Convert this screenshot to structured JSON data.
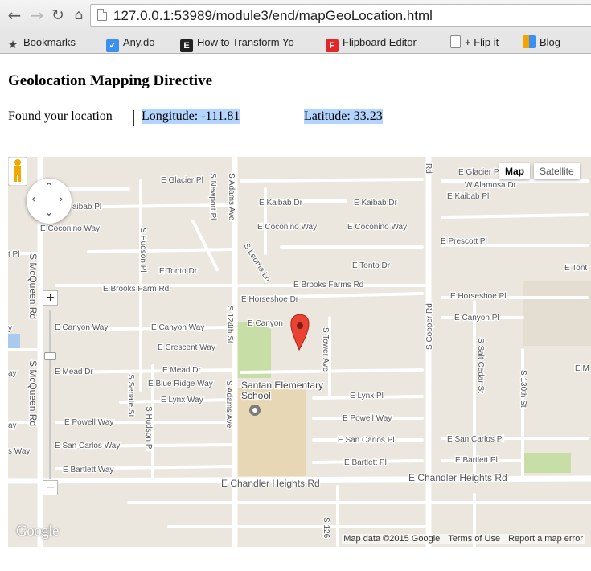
{
  "browser": {
    "url_host": "127.0.0.1",
    "url_rest": ":53989/module3/end/mapGeoLocation.html",
    "bookmarks": [
      {
        "label": "Bookmarks",
        "icon": "star-icon"
      },
      {
        "label": "Any.do",
        "icon": "anydo-icon"
      },
      {
        "label": "How to Transform Yo",
        "icon": "e-icon"
      },
      {
        "label": "Flipboard Editor",
        "icon": "flipboard-icon"
      },
      {
        "label": "+ Flip it",
        "icon": "page-icon"
      },
      {
        "label": "Blog",
        "icon": "blog-icon"
      }
    ]
  },
  "page": {
    "title": "Geolocation Mapping Directive",
    "status_text": "Found your location",
    "longitude_label": "Longitude: -111.81",
    "latitude_label": "Latitude: 33.23"
  },
  "map": {
    "type_buttons": [
      "Map",
      "Satellite"
    ],
    "active_type": "Map",
    "zoom_in": "+",
    "zoom_out": "−",
    "logo": "Google",
    "attribution": [
      "Map data ©2015 Google",
      "Terms of Use",
      "Report a map error"
    ],
    "school_label_line1": "Santan Elementary",
    "school_label_line2": "School",
    "street_labels": [
      "E Glacier Pl",
      "S Newport Pl",
      "S Adams Ave",
      "E Kaibab Dr",
      "E Kaibab Dr",
      "E Coconino Way",
      "E Coconino Way",
      "E Coconino Way",
      "S Hudson Pl",
      "S Leoma Ln",
      "E Tonto Dr",
      "E Tonto Dr",
      "E Brooks Farm Rd",
      "E Brooks Farms Rd",
      "E Horseshoe Dr",
      "E Horseshoe Pl",
      "S 124th St",
      "E Canyon Way",
      "E Canyon Way",
      "E Canyon",
      "E Canyon Pl",
      "E Crescent Way",
      "S Tower Ave",
      "E Mead Dr",
      "E Mead Dr",
      "S Senate St",
      "E Blue Ridge Way",
      "S Adams Ave",
      "E Lynx Way",
      "E Lynx Pl",
      "S Cooper Rd",
      "S Salt Cedar St",
      "S 130th St",
      "E Powell Way",
      "E Powell Way",
      "S Hudson Pl",
      "E San Carlos Way",
      "E San Carlos Pl",
      "E San Carlos Pl",
      "E Bartlett Way",
      "E Bartlett Pl",
      "E Bartlett Pl",
      "E Chandler Heights Rd",
      "E Chandler Heights Rd",
      "S McQueen Rd",
      "S McQueen Rd",
      "E Prescott Pl",
      "W Alamosa Dr",
      "E Kaibab Pl",
      "E Glacier Pl",
      "aibab Pl",
      "E Tont",
      "t Pl",
      "E M",
      "S 126",
      "Rd",
      "y",
      "ay",
      "s Way",
      "ay"
    ]
  }
}
